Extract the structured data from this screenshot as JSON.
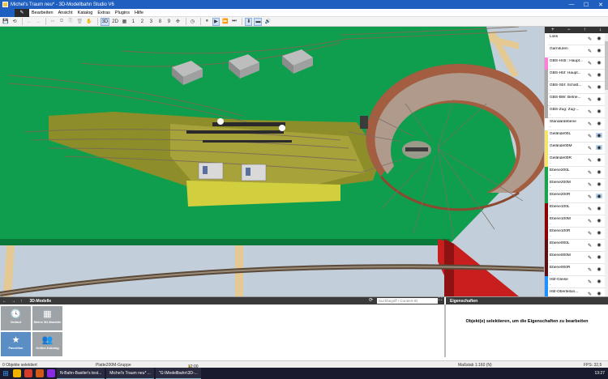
{
  "window": {
    "title": "Michel's Traum neu* - 3D-Modellbahn Studio V6",
    "min": "—",
    "max": "☐",
    "close": "✕"
  },
  "menu": [
    "Bearbeiten",
    "Ansicht",
    "Katalog",
    "Extras",
    "Plugins",
    "Hilfe"
  ],
  "toolbar": {
    "tools": [
      "💾",
      "⟲",
      "⎌",
      "←",
      "→",
      "✂",
      "⧉",
      "⎘",
      "🗑",
      "✋"
    ],
    "view_modes": [
      "3D",
      "2D",
      "▦",
      "1",
      "2",
      "3",
      "8",
      "9",
      "✣"
    ],
    "playback": [
      "◷",
      "⏸",
      "▶",
      "⏩",
      "⏭",
      "⏭"
    ],
    "extra": [
      "⬇",
      "▬",
      "🔊"
    ]
  },
  "layers_header": [
    "+",
    "−",
    "↑",
    "↓"
  ],
  "layers": [
    {
      "name": "Loks",
      "sub": "",
      "color": "#ffffff",
      "eye_hl": false
    },
    {
      "name": "Garnituren",
      "sub": "",
      "color": "#ffffff",
      "eye_hl": false
    },
    {
      "name": "GBS-Hstr.: Haupt...",
      "sub": "-",
      "color": "#ff7fd6",
      "eye_hl": false
    },
    {
      "name": "GBS-Hbf: Haupt...",
      "sub": "-",
      "color": "#a9a9a9",
      "eye_hl": false
    },
    {
      "name": "GBS-Sbf: Schatt...",
      "sub": "-",
      "color": "#a9a9a9",
      "eye_hl": false
    },
    {
      "name": "GBS-BW: Betrie...",
      "sub": "-",
      "color": "#a9a9a9",
      "eye_hl": false
    },
    {
      "name": "GBS-Zug: Zug-...",
      "sub": "-",
      "color": "#a9a9a9",
      "eye_hl": false
    },
    {
      "name": "Standardebene",
      "sub": "-",
      "color": "#ffffff",
      "eye_hl": false
    },
    {
      "name": "Gelände00L",
      "sub": "-",
      "color": "#f5e56b",
      "eye_hl": true
    },
    {
      "name": "Gelände00M",
      "sub": "-",
      "color": "#f5e56b",
      "eye_hl": true
    },
    {
      "name": "Gelände00R",
      "sub": "-",
      "color": "#f5e56b",
      "eye_hl": false
    },
    {
      "name": "Ebene200L",
      "sub": "-",
      "color": "#1aa34a",
      "eye_hl": false
    },
    {
      "name": "Ebene200M",
      "sub": "-",
      "color": "#1aa34a",
      "eye_hl": false
    },
    {
      "name": "Ebene200R",
      "sub": "-",
      "color": "#1aa34a",
      "eye_hl": true
    },
    {
      "name": "Ebene100L",
      "sub": "-",
      "color": "#8b0000",
      "eye_hl": false
    },
    {
      "name": "Ebene100M",
      "sub": "-",
      "color": "#8b0000",
      "eye_hl": false
    },
    {
      "name": "Ebene100R",
      "sub": "-",
      "color": "#8b0000",
      "eye_hl": false
    },
    {
      "name": "Ebene000L",
      "sub": "-",
      "color": "#5a1010",
      "eye_hl": false
    },
    {
      "name": "Ebene000M",
      "sub": "-",
      "color": "#5a1010",
      "eye_hl": false
    },
    {
      "name": "Ebene000R",
      "sub": "-",
      "color": "#5a1010",
      "eye_hl": false
    },
    {
      "name": "Hbf-Gleise",
      "sub": "-",
      "color": "#1e90ff",
      "eye_hl": false
    },
    {
      "name": "Hbf-Oberleitun...",
      "sub": "",
      "color": "#1e90ff",
      "eye_hl": false
    }
  ],
  "catalog": {
    "nav": [
      "←",
      "→",
      "↑"
    ],
    "title": "3D-Modelle",
    "search_placeholder": "Suchbegriff / Content-ID",
    "tiles": [
      {
        "icon": "🕓",
        "label": "Verlauf",
        "selected": false
      },
      {
        "icon": "▦",
        "label": "Meine 3D-Modelle",
        "selected": false
      },
      {
        "icon": "★",
        "label": "Favoriten",
        "selected": true
      },
      {
        "icon": "👥",
        "label": "Online-Katalog",
        "selected": false
      }
    ]
  },
  "properties": {
    "title": "Eigenschaften",
    "message": "Objekt(e) selektieren, um die Eigenschaften zu bearbeiten"
  },
  "status": {
    "selection": "0 Objekte selektiert",
    "object": "Platte200M-Gruppe",
    "time": "12:00",
    "scale": "Maßstab 1:160 (N)",
    "fps": "FPS: 32,5"
  },
  "taskbar": {
    "tasks": [
      "N-Bahn-Bastler's test...",
      "Michel's Traum neu* ...",
      "\"G:\\Modellbahn\\3D-..."
    ],
    "clock": "13:27"
  }
}
